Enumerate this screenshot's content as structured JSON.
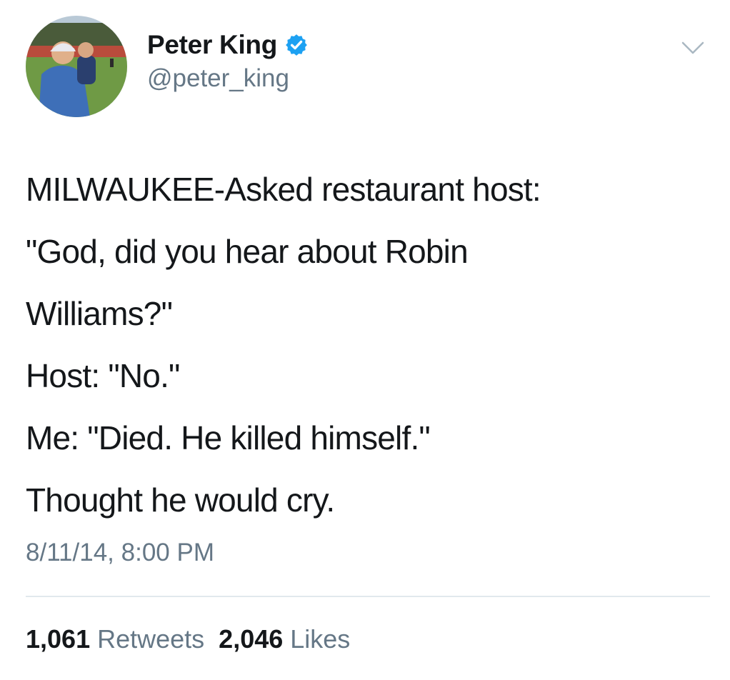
{
  "tweet": {
    "author": {
      "display_name": "Peter King",
      "handle": "@peter_king",
      "verified": true,
      "avatar": "profile-photo-icon"
    },
    "menu_icon": "chevron-down-icon",
    "text_lines": [
      "MILWAUKEE-Asked restaurant host:",
      "\"God, did you hear about Robin",
      "Williams?\"",
      "Host: \"No.\"",
      "Me: \"Died. He killed himself.\"",
      "Thought he would cry."
    ],
    "timestamp": "8/11/14, 8:00 PM",
    "stats": {
      "retweets_count": "1,061",
      "retweets_label": "Retweets",
      "likes_count": "2,046",
      "likes_label": "Likes"
    }
  },
  "colors": {
    "primary_text": "#14171a",
    "secondary_text": "#657786",
    "verified_blue": "#1da1f2",
    "divider": "#e1e8ed"
  }
}
